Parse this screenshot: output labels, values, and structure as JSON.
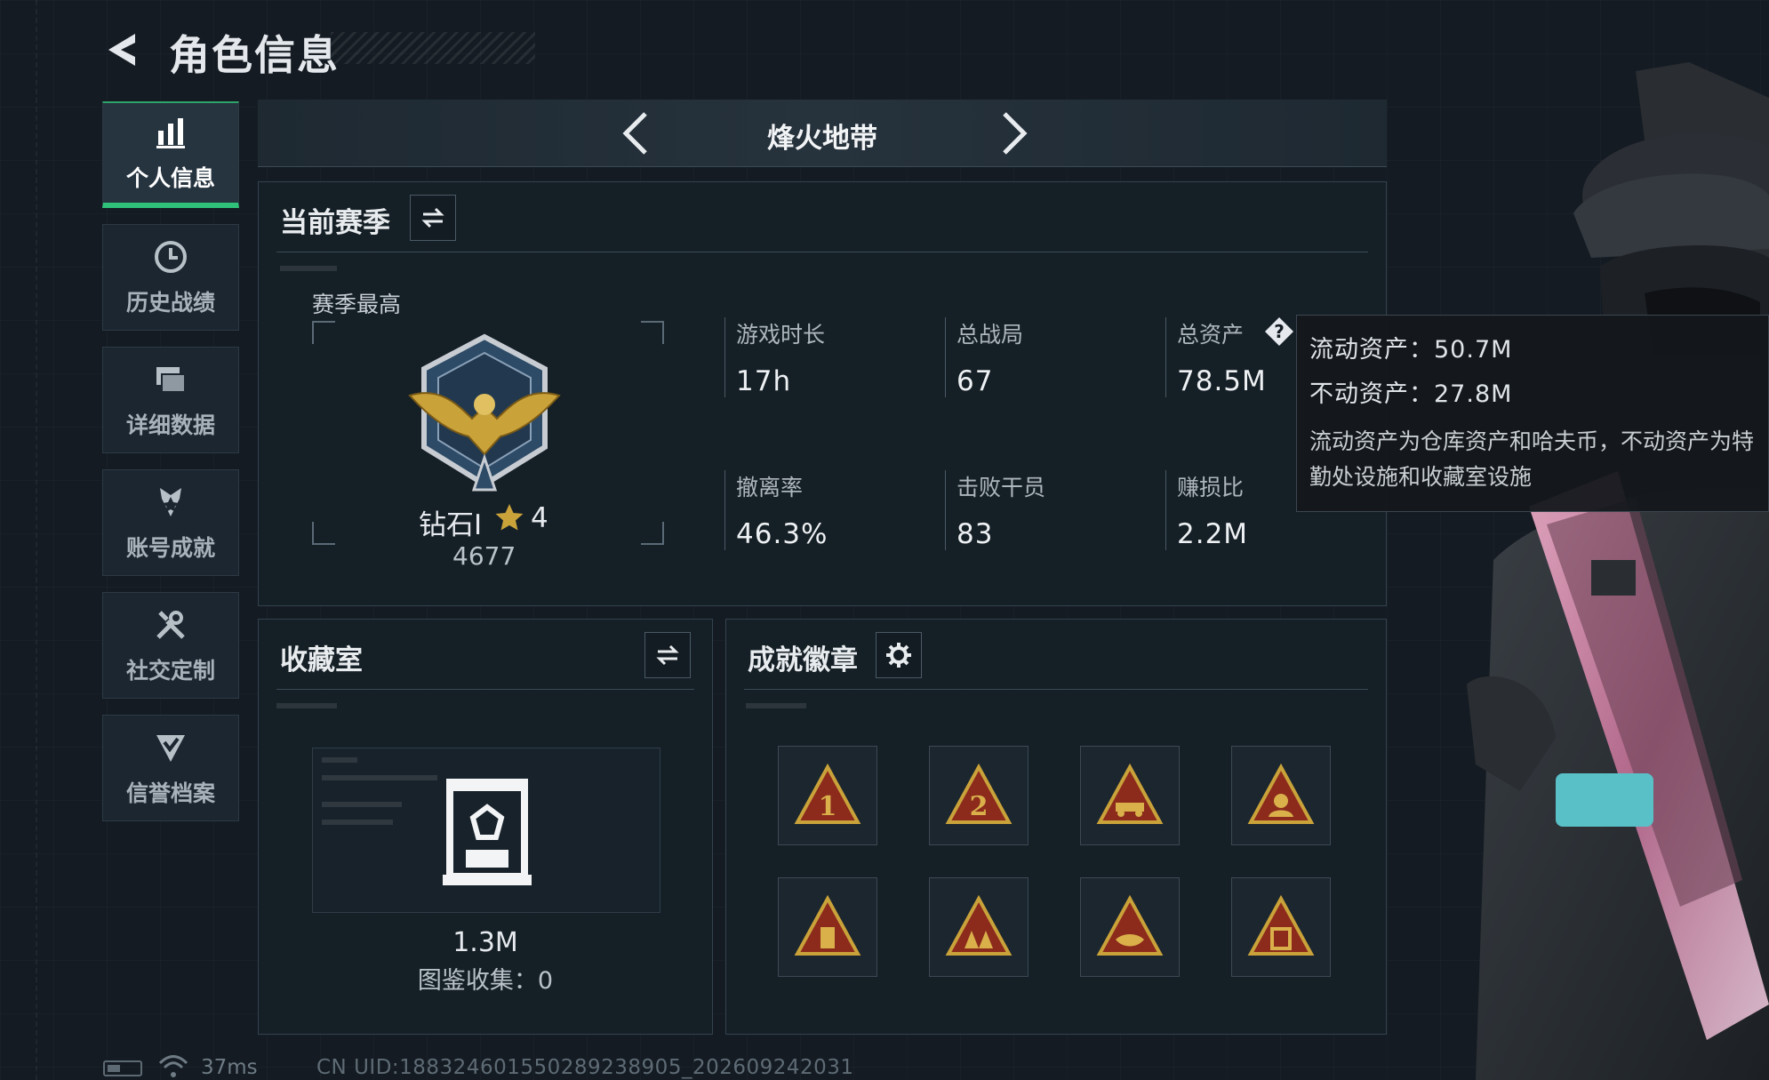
{
  "header": {
    "title": "角色信息"
  },
  "nav": {
    "items": [
      {
        "label": "个人信息",
        "icon": "bar-chart-icon",
        "active": true
      },
      {
        "label": "历史战绩",
        "icon": "clock-icon",
        "active": false
      },
      {
        "label": "详细数据",
        "icon": "stacked-cards-icon",
        "active": false
      },
      {
        "label": "账号成就",
        "icon": "medal-icon",
        "active": false
      },
      {
        "label": "社交定制",
        "icon": "tools-icon",
        "active": false
      },
      {
        "label": "信誉档案",
        "icon": "shield-check-icon",
        "active": false
      }
    ]
  },
  "game_selector": {
    "title": "烽火地带"
  },
  "season": {
    "title": "当前赛季",
    "best_label": "赛季最高",
    "rank_name": "钻石Ⅰ",
    "rank_stars": "4",
    "rank_score": "4677",
    "stats": [
      {
        "label": "游戏时长",
        "value": "17h"
      },
      {
        "label": "总战局",
        "value": "67"
      },
      {
        "label": "总资产",
        "value": "78.5M"
      },
      {
        "label": "撤离率",
        "value": "46.3%"
      },
      {
        "label": "击败干员",
        "value": "83"
      },
      {
        "label": "赚损比",
        "value": "2.2M"
      }
    ]
  },
  "tooltip": {
    "liquid": "流动资产：50.7M",
    "fixed": "不动资产：27.8M",
    "note": "流动资产为仓库资产和哈夫币，不动资产为特勤处设施和收藏室设施"
  },
  "collection": {
    "title": "收藏室",
    "value": "1.3M",
    "count": "图鉴收集：0"
  },
  "achievements": {
    "title": "成就徽章",
    "badges": [
      "number-one-badge-icon",
      "number-two-badge-icon",
      "vehicle-badge-icon",
      "soldier-badge-icon",
      "bottle-badge-icon",
      "squad-badge-icon",
      "eagle-badge-icon",
      "crate-badge-icon"
    ]
  },
  "footer": {
    "ping": "37ms",
    "uid": "CN UID:188324601550289238905_202609242031"
  },
  "colors": {
    "accent": "#2fc17a",
    "gold": "#c9a23a",
    "badge_red": "#8c2a1c"
  }
}
